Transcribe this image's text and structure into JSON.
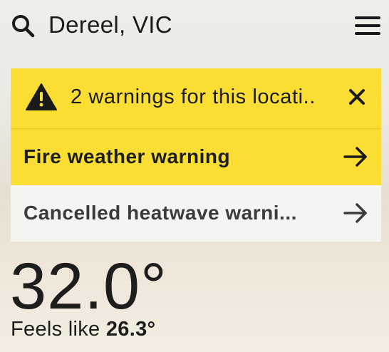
{
  "header": {
    "search_icon": "search-icon",
    "location": "Dereel, VIC",
    "menu_icon": "hamburger-menu-icon"
  },
  "warnings": {
    "summary": "2 warnings for this locati..",
    "alert_icon": "warning-triangle-icon",
    "close_icon": "close-icon",
    "colors": {
      "active": "#fade34",
      "cancelled": "#f4f4f2"
    },
    "items": [
      {
        "label": "Fire weather warning",
        "status": "active",
        "icon": "arrow-right-icon"
      },
      {
        "label": "Cancelled heatwave warni...",
        "status": "cancelled",
        "icon": "arrow-right-icon"
      }
    ]
  },
  "current": {
    "temperature": "32.0°",
    "feels_like_label": "Feels like",
    "feels_like_value": "26.3°"
  }
}
